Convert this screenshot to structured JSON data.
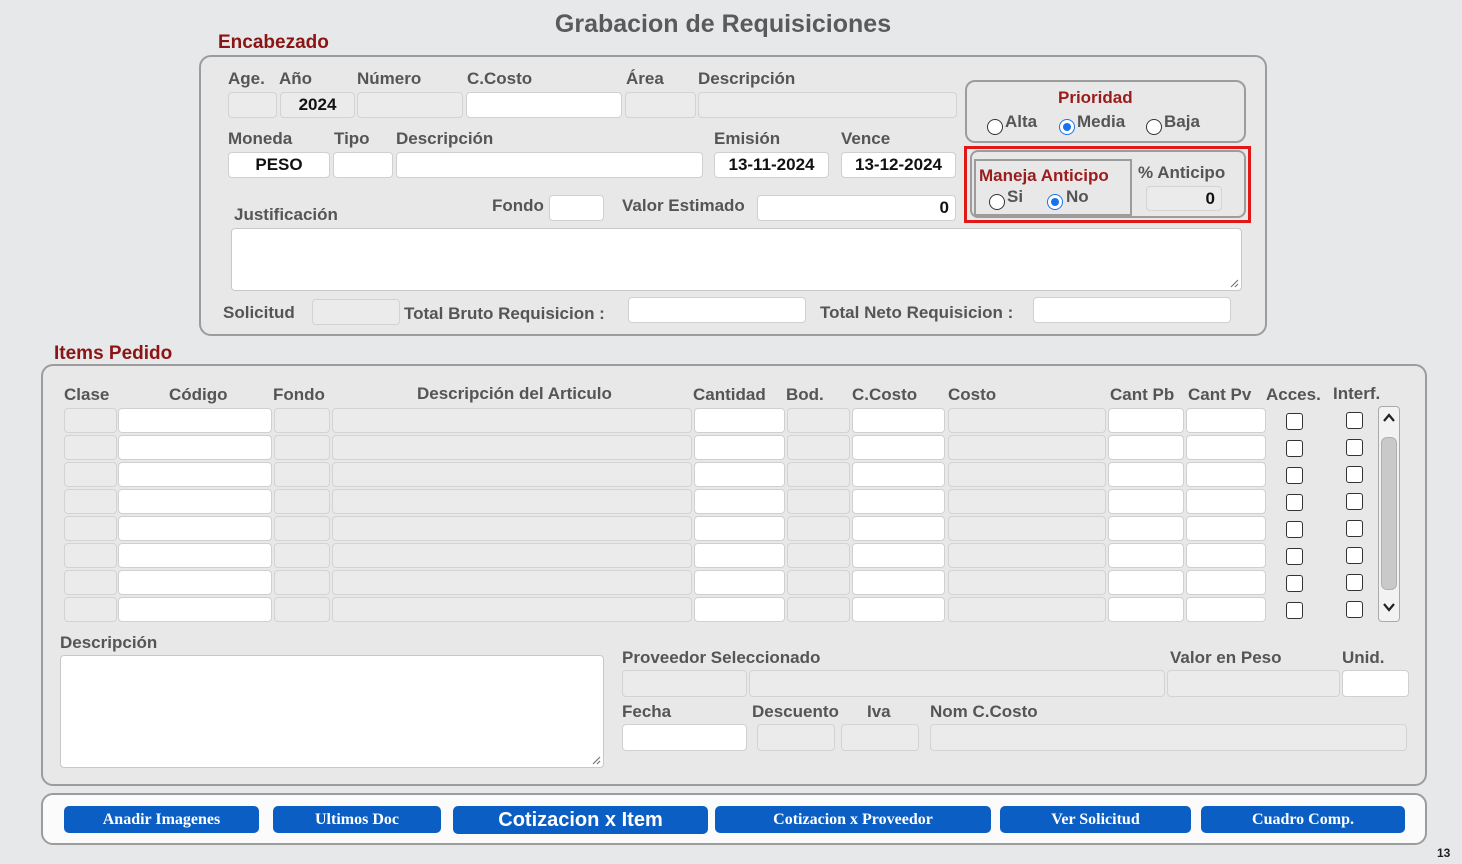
{
  "page": {
    "title": "Grabacion de Requisiciones",
    "page_number": "13"
  },
  "encabezado": {
    "legend": "Encabezado",
    "labels": {
      "age": "Age.",
      "anio": "Año",
      "numero": "Número",
      "ccosto": "C.Costo",
      "area": "Área",
      "descripcion": "Descripción",
      "moneda": "Moneda",
      "tipo": "Tipo",
      "descripcion2": "Descripción",
      "emision": "Emisión",
      "vence": "Vence",
      "justificacion": "Justificación",
      "fondo": "Fondo",
      "valor_estimado": "Valor Estimado",
      "solicitud": "Solicitud",
      "total_bruto": "Total Bruto Requisicion :",
      "total_neto": "Total Neto Requisicion :"
    },
    "values": {
      "anio": "2024",
      "moneda": "PESO",
      "emision": "13-11-2024",
      "vence": "13-12-2024",
      "valor_estimado": "0"
    },
    "prioridad": {
      "label": "Prioridad",
      "options": [
        "Alta",
        "Media",
        "Baja"
      ],
      "selected": "Media"
    },
    "anticipo": {
      "label": "Maneja Anticipo",
      "options": [
        "Si",
        "No"
      ],
      "selected": "No",
      "pct_label": "% Anticipo",
      "pct_value": "0",
      "highlight_color": "#e01818"
    }
  },
  "items": {
    "legend": "Items Pedido",
    "columns": [
      "Clase",
      "Código",
      "Fondo",
      "Descripción del Articulo",
      "Cantidad",
      "Bod.",
      "C.Costo",
      "Costo",
      "Cant Pb",
      "Cant Pv",
      "Acces.",
      "Interf."
    ],
    "row_count": 8,
    "detail": {
      "descripcion": "Descripción",
      "proveedor": "Proveedor Seleccionado",
      "valor_peso": "Valor en Peso",
      "unid": "Unid.",
      "fecha": "Fecha",
      "descuento": "Descuento",
      "iva": "Iva",
      "nom_ccosto": "Nom C.Costo"
    }
  },
  "buttons": {
    "anadir": "Anadir Imagenes",
    "ultimos": "Ultimos Doc",
    "cot_item": "Cotizacion x Item",
    "cot_prov": "Cotizacion x Proveedor",
    "ver_sol": "Ver Solicitud",
    "cuadro": "Cuadro Comp."
  },
  "colors": {
    "accent_button": "#0b5fc4",
    "legend_red": "#8b1414",
    "radio_selected": "#1a73e8"
  }
}
